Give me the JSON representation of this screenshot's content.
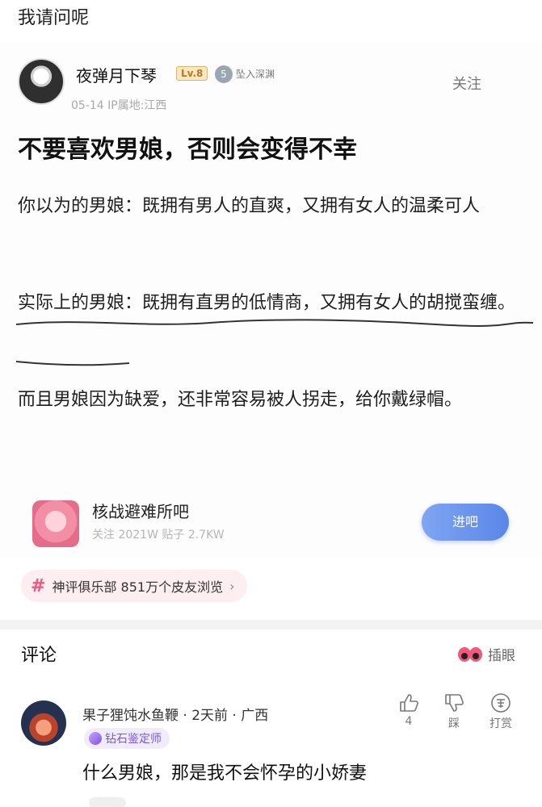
{
  "post": {
    "title": "我请问呢"
  },
  "screenshot": {
    "user": {
      "name": "夜弹月下琴",
      "level": "Lv.8",
      "medal_num": "5",
      "medal_text": "坠入深渊",
      "meta": "05-14   IP属地:江西"
    },
    "follow_label": "关注",
    "headline": "不要喜欢男娘，否则会变得不幸",
    "paragraphs": [
      "你以为的男娘：既拥有男人的直爽，又拥有女人的温柔可人",
      "实际上的男娘：既拥有直男的低情商，又拥有女人的胡搅蛮缠。",
      "而且男娘因为缺爱，还非常容易被人拐走，给你戴绿帽。"
    ],
    "bar": {
      "name": "核战避难所吧",
      "stats": "关注 2021W   贴子 2.7KW",
      "enter_label": "进吧"
    }
  },
  "topic": {
    "text": "神评俱乐部  851万个皮友浏览",
    "chevron": "›"
  },
  "comments": {
    "title": "评论",
    "insert_eyes_label": "插眼",
    "items": [
      {
        "name": "果子狸饨水鱼鞭 · 2天前 · 广西",
        "badge": "钻石鉴定师",
        "text": "什么男娘，那是我不会怀孕的小娇妻",
        "likes": "4",
        "dislike_label": "踩",
        "reward_label": "打赏"
      }
    ]
  },
  "colors": {
    "accent_pink": "#f0587c",
    "button_blue": "#5a86e8",
    "badge_purple": "#7a55e0"
  }
}
